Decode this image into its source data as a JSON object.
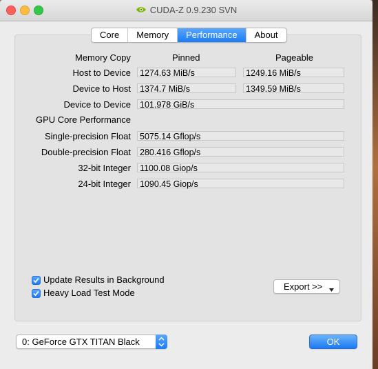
{
  "window": {
    "title": "CUDA-Z 0.9.230 SVN"
  },
  "tabs": [
    {
      "label": "Core"
    },
    {
      "label": "Memory"
    },
    {
      "label": "Performance",
      "active": true
    },
    {
      "label": "About"
    }
  ],
  "memory_copy": {
    "heading": "Memory Copy",
    "col_pinned": "Pinned",
    "col_pageable": "Pageable",
    "rows": [
      {
        "label": "Host to Device",
        "pinned": "1274.63 MiB/s",
        "pageable": "1249.16 MiB/s"
      },
      {
        "label": "Device to Host",
        "pinned": "1374.7 MiB/s",
        "pageable": "1349.59 MiB/s"
      },
      {
        "label": "Device to Device",
        "value": "101.978 GiB/s"
      }
    ]
  },
  "gpu_core": {
    "heading": "GPU Core Performance",
    "rows": [
      {
        "label": "Single-precision Float",
        "value": "5075.14 Gflop/s"
      },
      {
        "label": "Double-precision Float",
        "value": "280.416 Gflop/s"
      },
      {
        "label": "32-bit Integer",
        "value": "1100.08 Giop/s"
      },
      {
        "label": "24-bit Integer",
        "value": "1090.45 Giop/s"
      }
    ]
  },
  "options": {
    "update_background": {
      "label": "Update Results in Background",
      "checked": true
    },
    "heavy_load": {
      "label": "Heavy Load Test Mode",
      "checked": true
    }
  },
  "export_button": {
    "label": "Export >>"
  },
  "device_select": {
    "value": "0: GeForce GTX TITAN Black"
  },
  "ok_button": {
    "label": "OK"
  },
  "colors": {
    "accent": "#1c7cf4",
    "panel": "#e3e3e3",
    "window": "#ececec"
  }
}
